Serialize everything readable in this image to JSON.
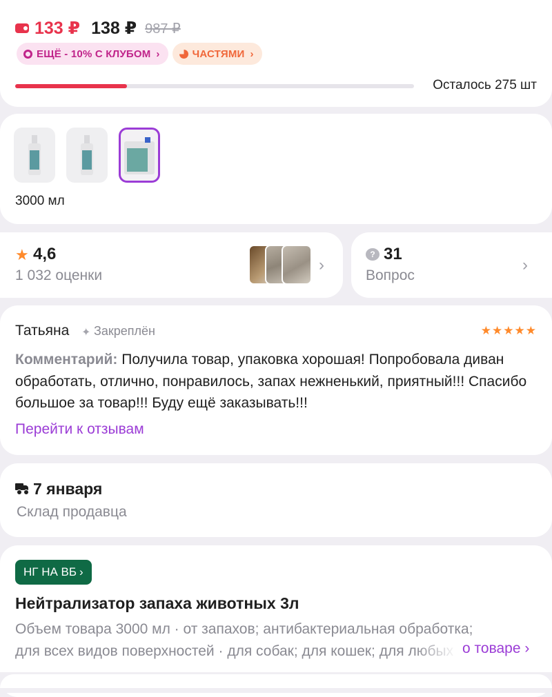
{
  "price": {
    "wallet_price": "133 ₽",
    "price": "138 ₽",
    "old_price": "987 ₽",
    "chips": {
      "club": "ЕЩЁ - 10% С КЛУБОМ",
      "parts": "ЧАСТЯМИ"
    },
    "stock_text": "Осталось 275 шт",
    "stock_fill_fraction": 0.28,
    "accent_color": "#e8334c"
  },
  "variants": {
    "items": [
      {
        "icon": "spray-bottle-icon",
        "selected": false
      },
      {
        "icon": "spray-bottle-icon",
        "selected": false
      },
      {
        "icon": "canister-icon",
        "selected": true
      }
    ],
    "selected_label": "3000 мл",
    "selected_color": "#9b3cd6"
  },
  "rating": {
    "value": "4,6",
    "count_text": "1 032 оценки",
    "star_color": "#ff8a2b"
  },
  "questions": {
    "count": "31",
    "label": "Вопрос"
  },
  "review": {
    "author": "Татьяна",
    "pinned_label": "Закреплён",
    "stars": "★★★★★",
    "comment_label": "Комментарий:",
    "comment_text": "Получила товар, упаковка хорошая! Попробовала диван обработать, отлично, понравилось, запах нежненький, приятный!!! Спасибо большое за товар!!! Буду ещё заказывать!!!",
    "link": "Перейти к отзывам",
    "link_color": "#9b3cd6"
  },
  "delivery": {
    "date": "7 января",
    "source": "Склад продавца"
  },
  "product": {
    "promo_badge": "НГ НА ВБ",
    "promo_color": "#0f6a45",
    "title": "Нейтрализатор запаха животных 3л",
    "desc_line1": "Объем товара 3000 мл · от запахов; антибактериальная обработка;",
    "desc_line2": "для всех видов поверхностей · для собак; для кошек; для любых",
    "about_link": "о товаре ›"
  }
}
